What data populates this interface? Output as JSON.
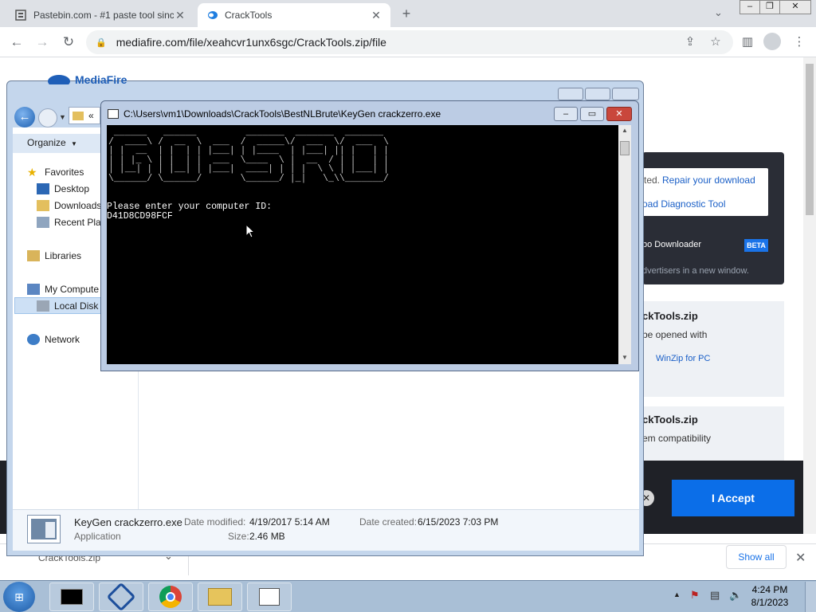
{
  "browser": {
    "tabs": [
      {
        "title": "Pastebin.com - #1 paste tool sinc",
        "active": false
      },
      {
        "title": "CrackTools",
        "active": true
      }
    ],
    "url": "mediafire.com/file/xeahcvr1unx6sgc/CrackTools.zip/file"
  },
  "page": {
    "repair_prefix": "ted.",
    "repair_link": "Repair your download",
    "diag_link": "oad Diagnostic Tool",
    "turbo": "bo Downloader",
    "beta": "BETA",
    "advertisers": "dvertisers in a new window.",
    "file1_title": "ckTools.zip",
    "file1_line": "be opened with",
    "winzip": "WinZip for PC",
    "file2_title": "ckTools.zip",
    "file2_line": "em compatibility",
    "accept": "I Accept",
    "download_item": "CrackTools.zip",
    "show_all": "Show all"
  },
  "explorer": {
    "breadcrumb": "«",
    "organize": "Organize",
    "nav": [
      "Favorites",
      "Desktop",
      "Downloads",
      "Recent Plac",
      "Libraries",
      "My Compute",
      "Local Disk (",
      "Network"
    ],
    "file_name": "KeyGen crackzerro.exe",
    "file_type": "Application",
    "modified_label": "Date modified:",
    "modified": "4/19/2017 5:14 AM",
    "created_label": "Date created:",
    "created": "6/15/2023 7:03 PM",
    "size_label": "Size:",
    "size": "2.46 MB"
  },
  "console": {
    "title": "C:\\Users\\vm1\\Downloads\\CrackTools\\BestNLBrute\\KeyGen crackzerro.exe",
    "prompt": "Please enter your computer ID:",
    "id_value": "D41D8CD98FCF"
  },
  "taskbar": {
    "time": "4:24 PM",
    "date": "8/1/2023"
  }
}
